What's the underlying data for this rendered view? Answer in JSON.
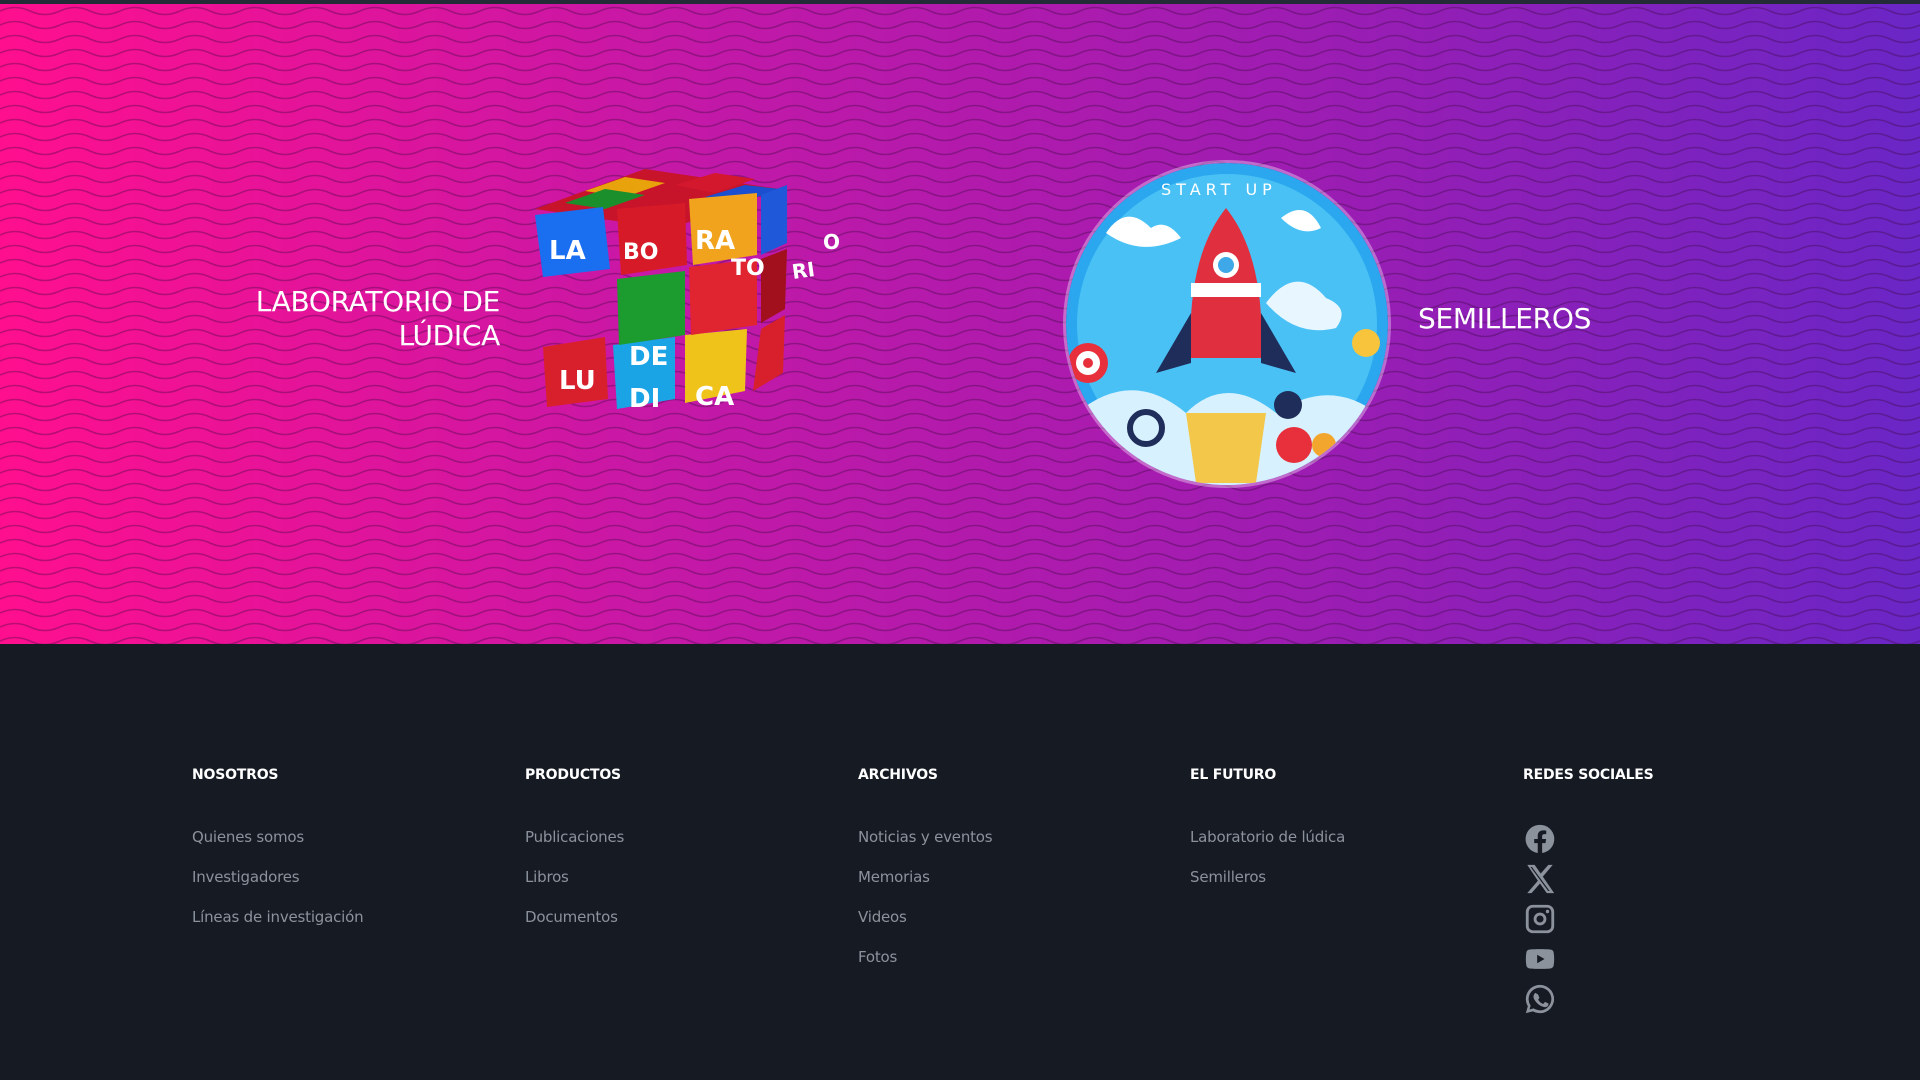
{
  "hero": {
    "lab_label_line1": "LABORATORIO DE",
    "lab_label_line2": "LÚDICA",
    "semilleros_label": "SEMILLEROS",
    "cube_letters": [
      "LA",
      "BO",
      "RA",
      "TO",
      "RI",
      "O",
      "DE",
      "LU",
      "DI",
      "CA"
    ],
    "badge_text": "START UP",
    "colors": {
      "gradient_start": "#ff0f8e",
      "gradient_end": "#6a26c6"
    }
  },
  "footer": {
    "background": "#151a23",
    "columns": [
      {
        "title": "NOSOTROS",
        "links": [
          "Quienes somos",
          "Investigadores",
          "Líneas de investigación"
        ]
      },
      {
        "title": "PRODUCTOS",
        "links": [
          "Publicaciones",
          "Libros",
          "Documentos"
        ]
      },
      {
        "title": "ARCHIVOS",
        "links": [
          "Noticias y eventos",
          "Memorias",
          "Videos",
          "Fotos"
        ]
      },
      {
        "title": "EL FUTURO",
        "links": [
          "Laboratorio de lúdica",
          "Semilleros"
        ]
      }
    ],
    "social": {
      "title": "REDES SOCIALES",
      "icons": [
        "facebook-icon",
        "x-icon",
        "instagram-icon",
        "youtube-icon",
        "whatsapp-icon"
      ]
    }
  }
}
